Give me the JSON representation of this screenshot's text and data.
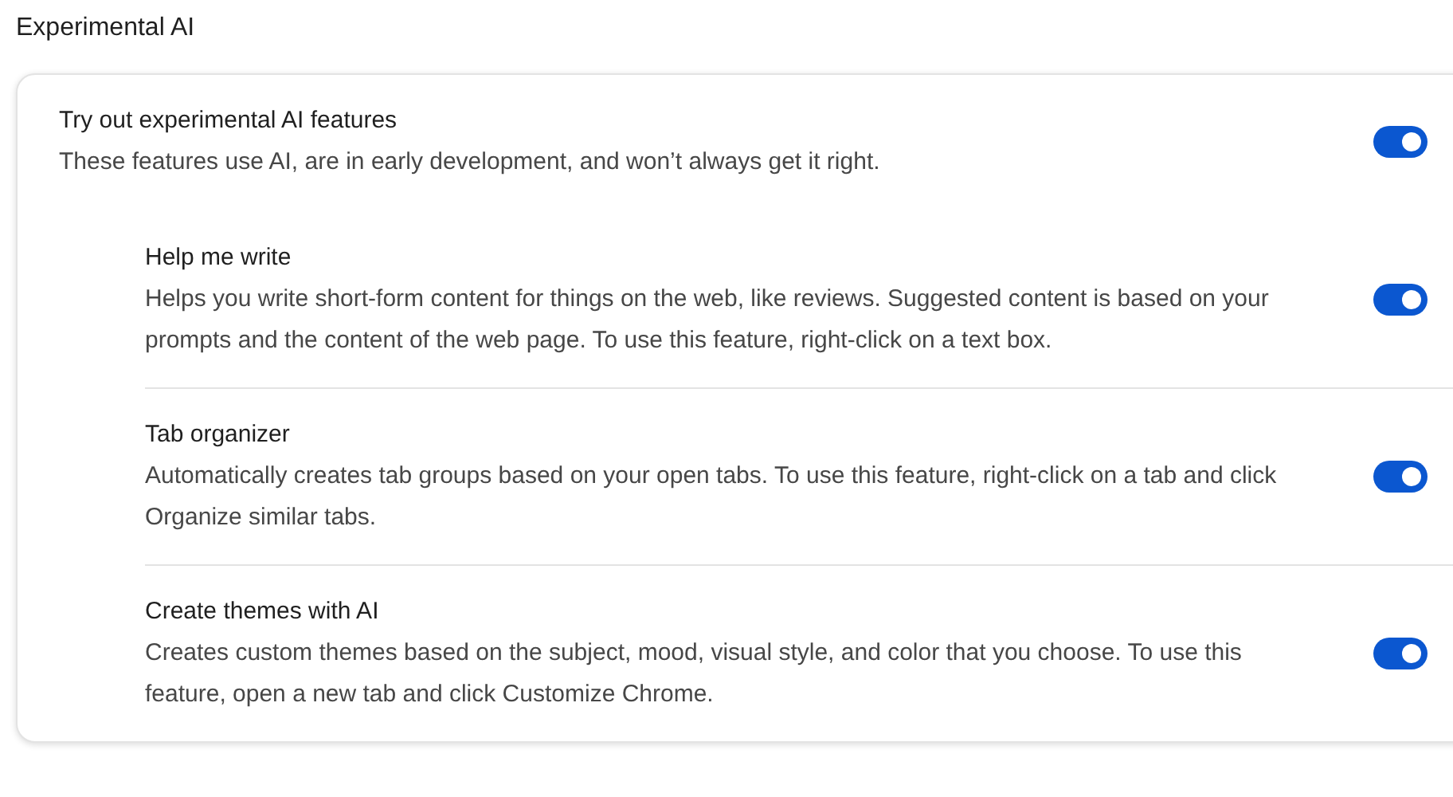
{
  "section_title": "Experimental AI",
  "main": {
    "title": "Try out experimental AI features",
    "description": "These features use AI, are in early development, and won’t always get it right.",
    "on": true
  },
  "features": [
    {
      "title": "Help me write",
      "description": "Helps you write short-form content for things on the web, like reviews. Suggested content is based on your prompts and the content of the web page. To use this feature, right-click on a text box.",
      "on": true
    },
    {
      "title": "Tab organizer",
      "description": "Automatically creates tab groups based on your open tabs. To use this feature, right-click on a tab and click Organize similar tabs.",
      "on": true
    },
    {
      "title": "Create themes with AI",
      "description": "Creates custom themes based on the subject, mood, visual style, and color that you choose. To use this feature, open a new tab and click Customize Chrome.",
      "on": true
    }
  ]
}
